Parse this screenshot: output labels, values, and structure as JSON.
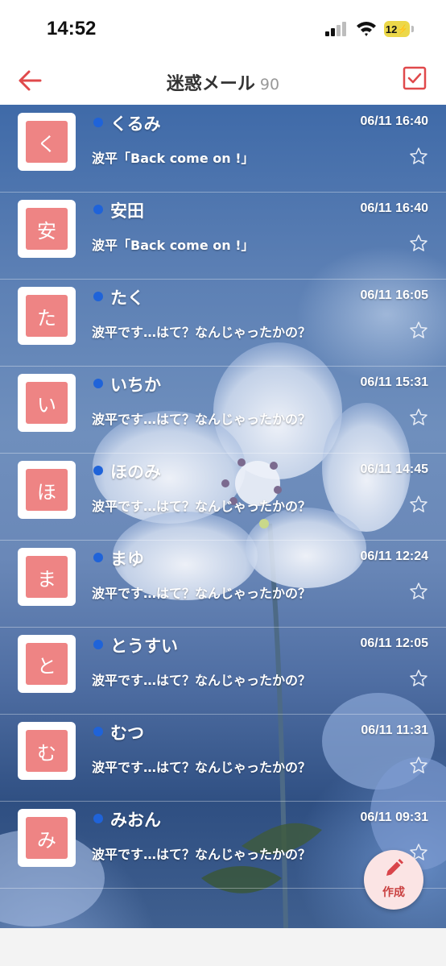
{
  "status_bar": {
    "time": "14:52",
    "battery": "12"
  },
  "header": {
    "title": "迷惑メール",
    "count": "90",
    "back_icon": "arrow-left-icon",
    "select_icon": "checkbox-icon"
  },
  "colors": {
    "accent": "#e0494b",
    "avatar_bg": "#ee8484",
    "unread_dot": "#1f63d9",
    "fab_bg": "#fbe4e4"
  },
  "messages": [
    {
      "initial": "く",
      "sender": "くるみ",
      "date": "06/11 16:40",
      "subject": "波平「Back come on !」",
      "unread": true,
      "starred": false
    },
    {
      "initial": "安",
      "sender": "安田",
      "date": "06/11 16:40",
      "subject": "波平「Back come on !」",
      "unread": true,
      "starred": false
    },
    {
      "initial": "た",
      "sender": "たく",
      "date": "06/11 16:05",
      "subject": "波平です…はて？なんじゃったかの？",
      "unread": true,
      "starred": false
    },
    {
      "initial": "い",
      "sender": "いちか",
      "date": "06/11 15:31",
      "subject": "波平です…はて？なんじゃったかの？",
      "unread": true,
      "starred": false
    },
    {
      "initial": "ほ",
      "sender": "ほのみ",
      "date": "06/11 14:45",
      "subject": "波平です…はて？なんじゃったかの？",
      "unread": true,
      "starred": false
    },
    {
      "initial": "ま",
      "sender": "まゆ",
      "date": "06/11 12:24",
      "subject": "波平です…はて？なんじゃったかの？",
      "unread": true,
      "starred": false
    },
    {
      "initial": "と",
      "sender": "とうすい",
      "date": "06/11 12:05",
      "subject": "波平です…はて？なんじゃったかの？",
      "unread": true,
      "starred": false
    },
    {
      "initial": "む",
      "sender": "むつ",
      "date": "06/11 11:31",
      "subject": "波平です…はて？なんじゃったかの？",
      "unread": true,
      "starred": false
    },
    {
      "initial": "み",
      "sender": "みおん",
      "date": "06/11 09:31",
      "subject": "波平です…はて？なんじゃったかの？",
      "unread": true,
      "starred": false
    }
  ],
  "fab": {
    "label": "作成",
    "icon": "pencil-icon"
  }
}
